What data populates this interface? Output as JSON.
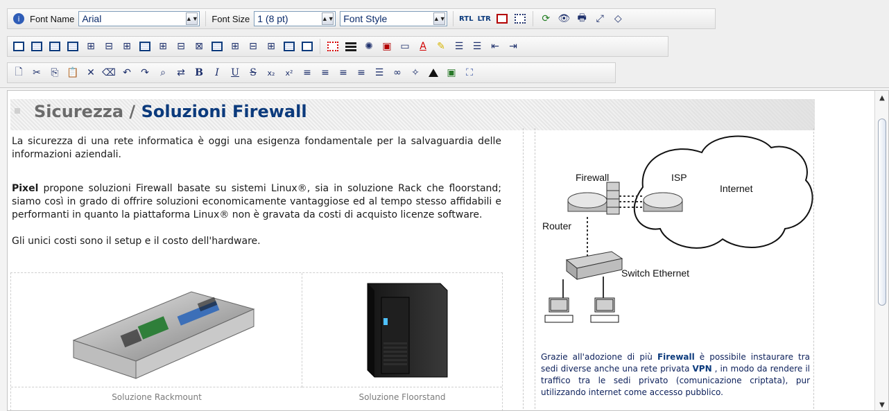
{
  "toolbar": {
    "row1": {
      "font_name_label": "Font Name",
      "font_name_value": "Arial",
      "font_size_label": "Font Size",
      "font_size_value": "1 (8 pt)",
      "font_style_value": "Font Style",
      "icons": [
        "info-icon",
        "rtl-icon",
        "ltr-icon",
        "page-properties-icon",
        "select-all-icon",
        "refresh-icon",
        "preview-icon",
        "print-icon",
        "fullscreen-icon",
        "source-code-icon"
      ]
    },
    "row2": {
      "icons": [
        "insert-table-icon",
        "table-grid-icon",
        "table-properties-icon",
        "cell-properties-icon",
        "insert-row-above-icon",
        "insert-row-below-icon",
        "insert-row-after-icon",
        "merge-rows-icon",
        "insert-column-before-icon",
        "insert-column-after-icon",
        "delete-column-icon",
        "table-header-icon",
        "split-cell-icon",
        "merge-cells-icon",
        "table-borders-icon",
        "toggle-borders-icon",
        "dotted-border-icon",
        "horizontal-rule-icon",
        "insert-image-icon",
        "insert-date-icon",
        "insert-form-icon",
        "font-color-icon",
        "highlight-icon",
        "unordered-list-icon",
        "ordered-list-icon",
        "outdent-icon",
        "indent-icon"
      ]
    },
    "row3": {
      "icons": [
        "new-document-icon",
        "cut-icon",
        "copy-icon",
        "paste-icon",
        "delete-icon",
        "eraser-icon",
        "undo-icon",
        "redo-icon",
        "find-icon",
        "replace-icon",
        "bold-icon",
        "italic-icon",
        "underline-icon",
        "strikethrough-icon",
        "subscript-icon",
        "superscript-icon",
        "align-left-icon",
        "align-center-icon",
        "align-right-icon",
        "justify-icon",
        "justify-full-icon",
        "link-icon",
        "unlink-icon",
        "anchor-icon",
        "insert-picture-icon",
        "insert-media-icon"
      ]
    }
  },
  "editor": {
    "title_gray": "Sicurezza /",
    "title_blue": "Soluzioni Firewall",
    "p1": "La sicurezza di una rete informatica è oggi una esigenza fondamentale per la salvaguardia delle informazioni aziendali.",
    "p2_bold": "Pixel",
    "p2_rest": " propone soluzioni Firewall basate su sistemi Linux®, sia in soluzione Rack che floorstand; siamo così in grado di offrire soluzioni economicamente vantaggiose ed al tempo stesso affidabili e performanti in quanto la piattaforma Linux® non è gravata da costi di acquisto licenze software.",
    "p3": "Gli unici costi sono il setup e il costo dell'hardware.",
    "caption_rack": "Soluzione Rackmount",
    "caption_floor": "Soluzione Floorstand",
    "side": {
      "diagram": {
        "firewall": "Firewall",
        "isp": "ISP",
        "internet": "Internet",
        "router": "Router",
        "switch": "Switch Ethernet"
      },
      "text_before": "Grazie all'adozione di più ",
      "bold1": "Firewall",
      "text_mid": " è possibile instaurare tra sedi diverse anche una rete privata ",
      "bold2": "VPN",
      "text_after": " , in modo da rendere il traffico tra le sedi privato (comunicazione criptata), pur utilizzando internet come accesso pubblico."
    }
  }
}
